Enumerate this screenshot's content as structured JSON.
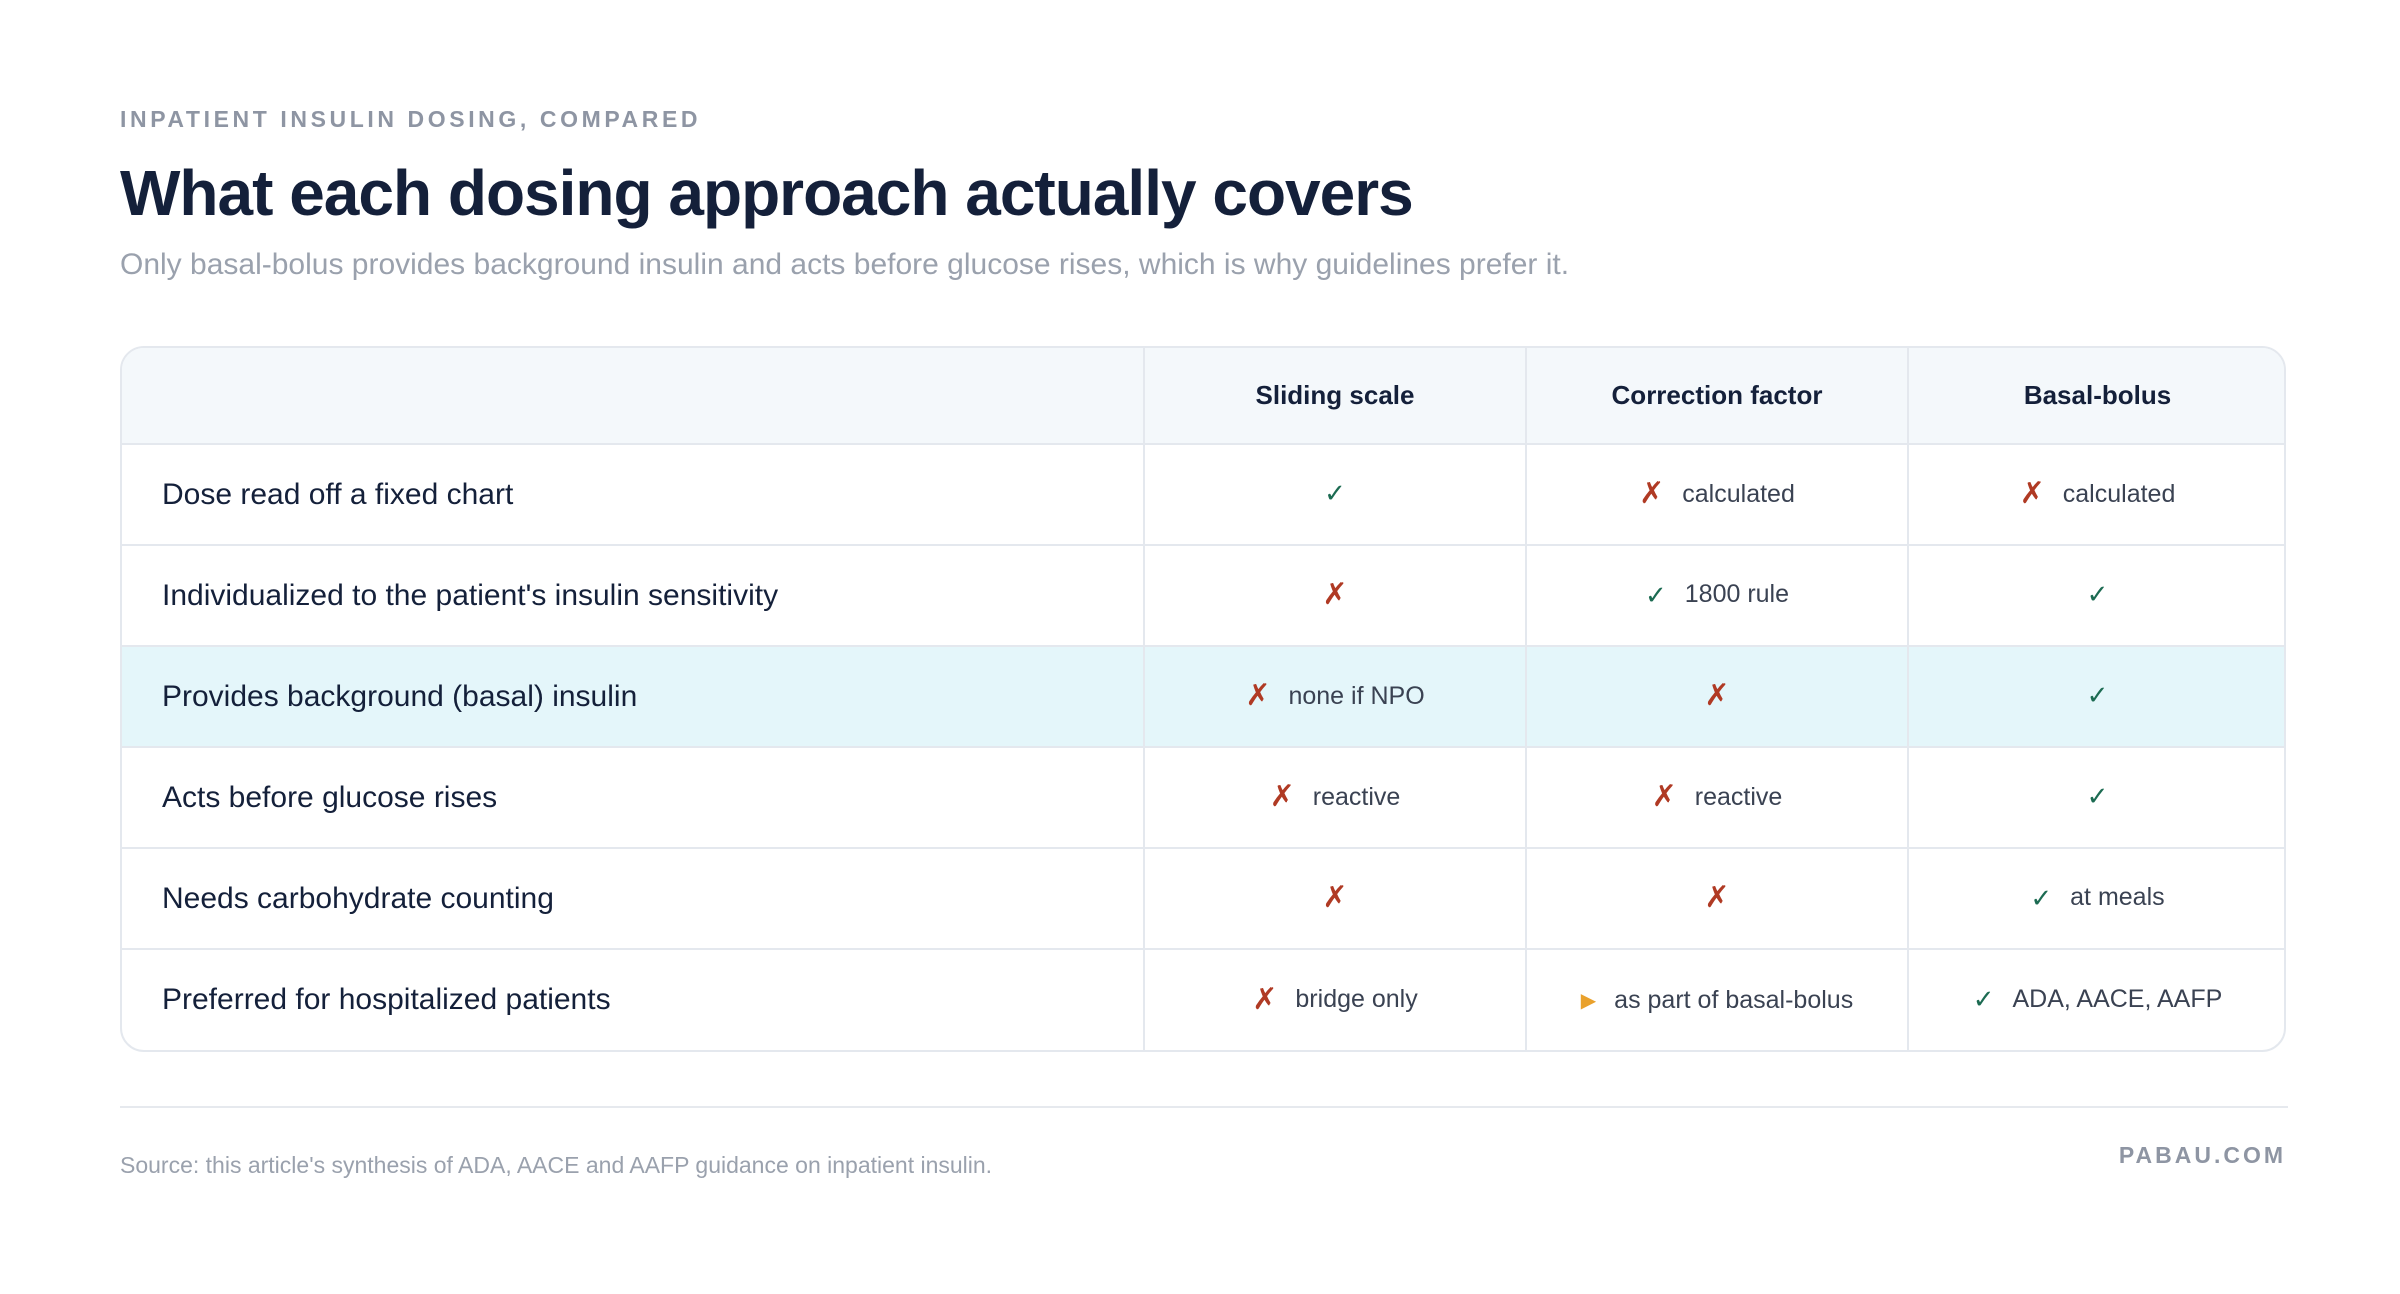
{
  "header": {
    "eyebrow": "INPATIENT INSULIN DOSING, COMPARED",
    "title": "What each dosing approach actually covers",
    "subtitle": "Only basal-bolus provides background insulin and acts before glucose rises, which is why guidelines prefer it."
  },
  "table": {
    "columns": [
      "",
      "Sliding scale",
      "Correction factor",
      "Basal-bolus"
    ],
    "rows": [
      {
        "label": "Dose read off a fixed chart",
        "highlighted": false,
        "cells": [
          {
            "mark": "yes",
            "symbol": "✓",
            "note": ""
          },
          {
            "mark": "no",
            "symbol": "✗",
            "note": "calculated"
          },
          {
            "mark": "no",
            "symbol": "✗",
            "note": "calculated"
          }
        ]
      },
      {
        "label": "Individualized to the patient's insulin sensitivity",
        "highlighted": false,
        "cells": [
          {
            "mark": "no",
            "symbol": "✗",
            "note": ""
          },
          {
            "mark": "yes",
            "symbol": "✓",
            "note": "1800 rule"
          },
          {
            "mark": "yes",
            "symbol": "✓",
            "note": ""
          }
        ]
      },
      {
        "label": "Provides background (basal) insulin",
        "highlighted": true,
        "cells": [
          {
            "mark": "no",
            "symbol": "✗",
            "note": "none if NPO"
          },
          {
            "mark": "no",
            "symbol": "✗",
            "note": ""
          },
          {
            "mark": "yes",
            "symbol": "✓",
            "note": ""
          }
        ]
      },
      {
        "label": "Acts before glucose rises",
        "highlighted": false,
        "cells": [
          {
            "mark": "no",
            "symbol": "✗",
            "note": "reactive"
          },
          {
            "mark": "no",
            "symbol": "✗",
            "note": "reactive"
          },
          {
            "mark": "yes",
            "symbol": "✓",
            "note": ""
          }
        ]
      },
      {
        "label": "Needs carbohydrate counting",
        "highlighted": false,
        "cells": [
          {
            "mark": "no",
            "symbol": "✗",
            "note": ""
          },
          {
            "mark": "no",
            "symbol": "✗",
            "note": ""
          },
          {
            "mark": "yes",
            "symbol": "✓",
            "note": "at meals"
          }
        ]
      },
      {
        "label": "Preferred for hospitalized patients",
        "highlighted": false,
        "cells": [
          {
            "mark": "no",
            "symbol": "✗",
            "note": "bridge only"
          },
          {
            "mark": "partial",
            "symbol": "▶",
            "note": "as part of basal-bolus"
          },
          {
            "mark": "yes",
            "symbol": "✓",
            "note": "ADA, AACE, AAFP"
          }
        ]
      }
    ]
  },
  "colors": {
    "yes": "#1c6b52",
    "no": "#b03a24",
    "partial": "#e9a12c",
    "highlight_row": "#e4f6fa",
    "header_bg": "#f4f8fb"
  },
  "footer": {
    "source": "Source: this article's synthesis of ADA, AACE and AAFP guidance on inpatient insulin.",
    "brand": "PABAU.COM"
  }
}
